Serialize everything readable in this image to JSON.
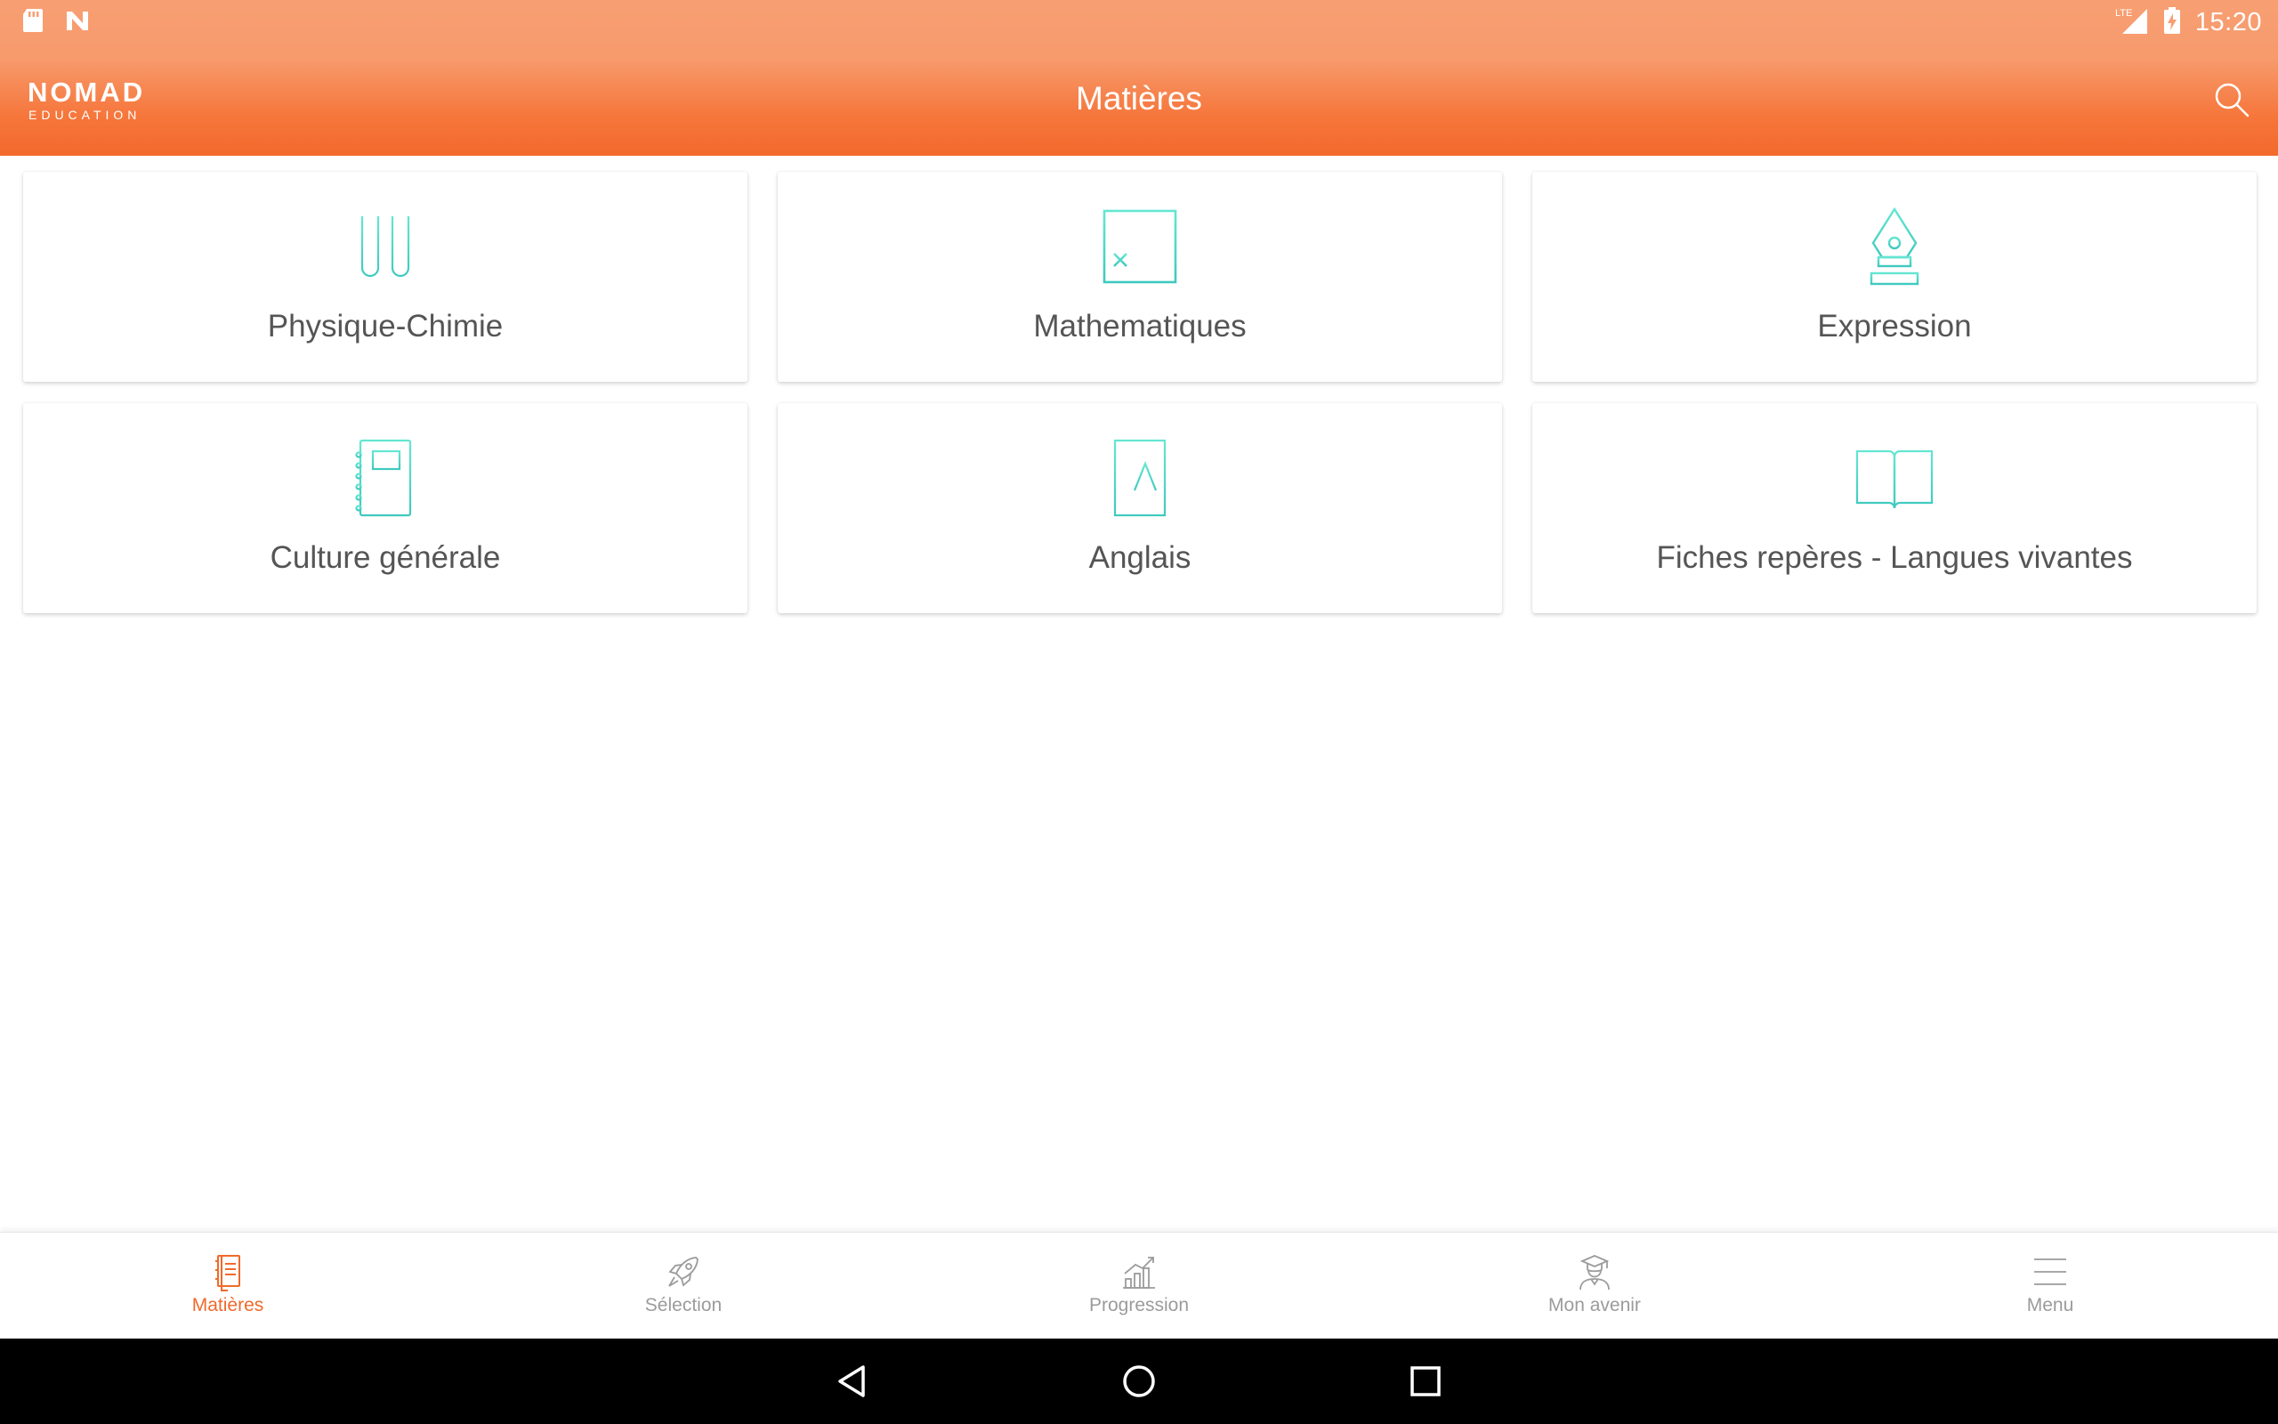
{
  "status_bar": {
    "time": "15:20",
    "network": "LTE",
    "left_icons": [
      "sd-card-icon",
      "n-notification-icon"
    ],
    "right_icons": [
      "signal-icon",
      "battery-charging-icon"
    ]
  },
  "app_bar": {
    "logo_main": "NOMAD",
    "logo_sub": "EDUCATION",
    "title": "Matières",
    "search_icon": "search-icon"
  },
  "subjects": [
    {
      "label": "Physique-Chimie",
      "icon": "test-tubes-icon"
    },
    {
      "label": "Mathematiques",
      "icon": "calculator-icon"
    },
    {
      "label": "Expression",
      "icon": "fountain-pen-icon"
    },
    {
      "label": "Culture générale",
      "icon": "notebook-icon"
    },
    {
      "label": "Anglais",
      "icon": "letter-book-icon"
    },
    {
      "label": "Fiches repères - Langues vivantes",
      "icon": "open-book-icon"
    }
  ],
  "bottom_nav": {
    "active": "Matières",
    "items": [
      {
        "label": "Matières",
        "icon": "notebook-icon"
      },
      {
        "label": "Sélection",
        "icon": "rocket-icon"
      },
      {
        "label": "Progression",
        "icon": "bar-chart-icon"
      },
      {
        "label": "Mon avenir",
        "icon": "graduate-icon"
      },
      {
        "label": "Menu",
        "icon": "hamburger-menu-icon"
      }
    ]
  },
  "colors": {
    "accent": "#f06a2b",
    "header_top": "#f79f73",
    "header_bottom": "#f3692c",
    "icon_teal": "#4fd3c4",
    "label_gray": "#555555",
    "nav_inactive": "#9b9b9b"
  }
}
